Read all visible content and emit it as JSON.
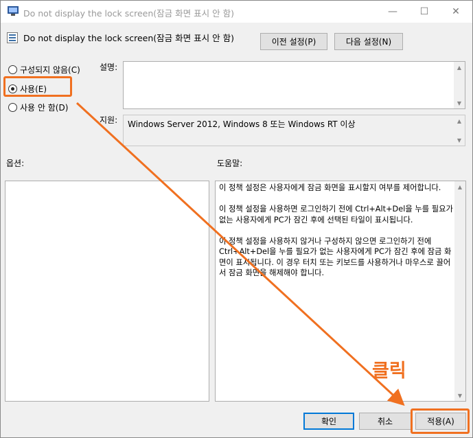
{
  "window": {
    "title": "Do not display the lock screen(잠금 화면 표시 안 함)",
    "controls": {
      "minimize": "—",
      "maximize": "☐",
      "close": "✕"
    }
  },
  "header": {
    "policy_name": "Do not display the lock screen(잠금 화면 표시 안 함)",
    "prev_button": "이전 설정(P)",
    "next_button": "다음 설정(N)"
  },
  "radios": [
    {
      "label": "구성되지 않음(C)",
      "checked": false
    },
    {
      "label": "사용(E)",
      "checked": true
    },
    {
      "label": "사용 안 함(D)",
      "checked": false
    }
  ],
  "labels": {
    "description": "설명:",
    "supported": "지원:",
    "options": "옵션:",
    "help": "도움말:"
  },
  "supported_text": "Windows Server 2012, Windows 8 또는 Windows RT 이상",
  "help_paragraphs": [
    "이 정책 설정은 사용자에게 잠금 화면을 표시할지 여부를 제어합니다.",
    "이 정책 설정을 사용하면 로그인하기 전에 Ctrl+Alt+Del을 누를 필요가 없는 사용자에게 PC가 잠긴 후에 선택된 타일이 표시됩니다.",
    "이 정책 설정을 사용하지 않거나 구성하지 않으면 로그인하기 전에 Ctrl+Alt+Del을 누를 필요가 없는 사용자에게 PC가 잠긴 후에 잠금 화면이 표시됩니다. 이 경우 터치 또는 키보드를 사용하거나 마우스로 끌어서 잠금 화면을 해제해야 합니다."
  ],
  "footer": {
    "ok": "확인",
    "cancel": "취소",
    "apply": "적용(A)"
  },
  "annotation": {
    "click_text": "클릭",
    "color": "#f07020"
  }
}
